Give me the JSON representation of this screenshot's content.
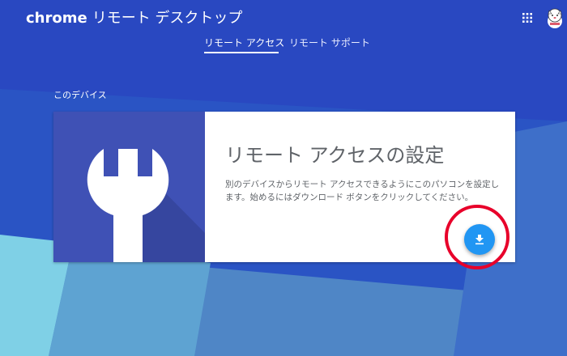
{
  "app": {
    "brand": "chrome",
    "product": "リモート デスクトップ"
  },
  "tabs": [
    {
      "label": "リモート アクセス",
      "selected": true
    },
    {
      "label": "リモート サポート",
      "selected": false
    }
  ],
  "section": {
    "label": "このデバイス"
  },
  "card": {
    "title": "リモート アクセスの設定",
    "description": "別のデバイスからリモート アクセスできるようにこのパソコンを設定します。始めるにはダウンロード ボタンをクリックしてください。",
    "art_icon": "wrench-icon",
    "button_icon": "download-icon"
  },
  "colors": {
    "background": "#2a54c4",
    "card_art": "#3f51b5",
    "button": "#2196f3",
    "highlight": "#e8002a"
  }
}
